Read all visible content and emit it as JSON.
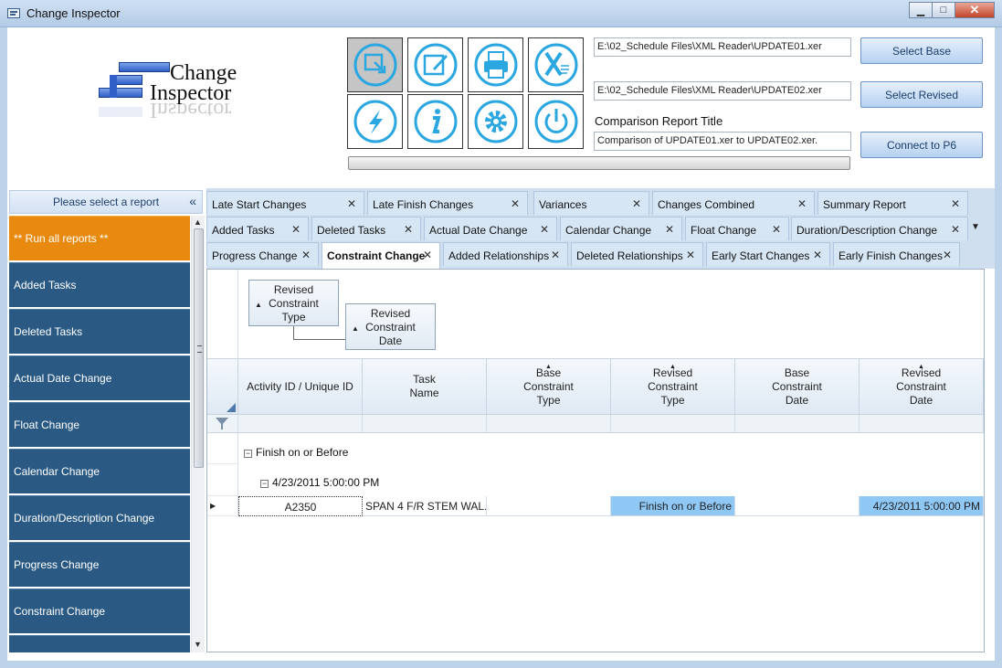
{
  "window": {
    "title": "Change Inspector",
    "minimize": "▁",
    "maximize": "□",
    "close": "✕"
  },
  "logo": {
    "line1": "Change",
    "line2": "Inspector",
    "reflection": "Inspector"
  },
  "toolbar_icons": [
    {
      "name": "import-icon",
      "active": true
    },
    {
      "name": "edit-icon",
      "active": false
    },
    {
      "name": "print-icon",
      "active": false
    },
    {
      "name": "excel-icon",
      "active": false
    },
    {
      "name": "lightning-icon",
      "active": false
    },
    {
      "name": "info-icon",
      "active": false
    },
    {
      "name": "settings-gear-icon",
      "active": false
    },
    {
      "name": "power-icon",
      "active": false
    }
  ],
  "files": {
    "base_path": "E:\\02_Schedule Files\\XML Reader\\UPDATE01.xer",
    "revised_path": "E:\\02_Schedule Files\\XML Reader\\UPDATE02.xer",
    "report_title_label": "Comparison Report Title",
    "report_title_value": "Comparison of UPDATE01.xer to UPDATE02.xer."
  },
  "buttons": {
    "select_base": "Select Base",
    "select_revised": "Select Revised",
    "connect_p6": "Connect to P6"
  },
  "sidebar": {
    "header": "Please select a report",
    "collapse": "«",
    "items": [
      "** Run all reports **",
      "Added Tasks",
      "Deleted Tasks",
      "Actual Date Change",
      "Float Change",
      "Calendar Change",
      "Duration/Description Change",
      "Progress Change",
      "Constraint Change",
      ""
    ],
    "scroll_up": "▲",
    "scroll_down": "▼"
  },
  "tabs": {
    "row1": [
      "Late Start Changes",
      "Late Finish Changes",
      "Variances",
      "Changes Combined",
      "Summary Report"
    ],
    "row2": [
      "Added Tasks",
      "Deleted Tasks",
      "Actual Date Change",
      "Calendar Change",
      "Float Change",
      "Duration/Description Change"
    ],
    "row3": [
      "Progress Change",
      "Constraint Change",
      "Added Relationships",
      "Deleted Relationships",
      "Early Start Changes",
      "Early Finish Changes"
    ],
    "active": "Constraint Change",
    "close_glyph": "✕",
    "more_glyph": "▼"
  },
  "grid": {
    "group_chips": [
      {
        "line1": "Revised",
        "line2": "Constraint",
        "line3": "Type"
      },
      {
        "line1": "Revised",
        "line2": "Constraint",
        "line3": "Date"
      }
    ],
    "columns": [
      {
        "l1": "Activity ID / Unique ID",
        "l2": "",
        "l3": "",
        "sort": false
      },
      {
        "l1": "Task",
        "l2": "Name",
        "l3": "",
        "sort": false
      },
      {
        "l1": "Base",
        "l2": "Constraint",
        "l3": "Type",
        "sort": true
      },
      {
        "l1": "Revised",
        "l2": "Constraint",
        "l3": "Type",
        "sort": true
      },
      {
        "l1": "Base",
        "l2": "Constraint",
        "l3": "Date",
        "sort": false
      },
      {
        "l1": "Revised",
        "l2": "Constraint",
        "l3": "Date",
        "sort": true
      }
    ],
    "group1": "Finish on or Before",
    "group2": "4/23/2011 5:00:00 PM",
    "row": {
      "activity_id": "A2350",
      "task_name": "SPAN 4 F/R STEM WAL...",
      "base_type": "",
      "revised_type": "Finish on or Before",
      "base_date": "",
      "revised_date": "4/23/2011 5:00:00 PM"
    },
    "collapse_glyph": "−",
    "row_pointer": "▶"
  }
}
